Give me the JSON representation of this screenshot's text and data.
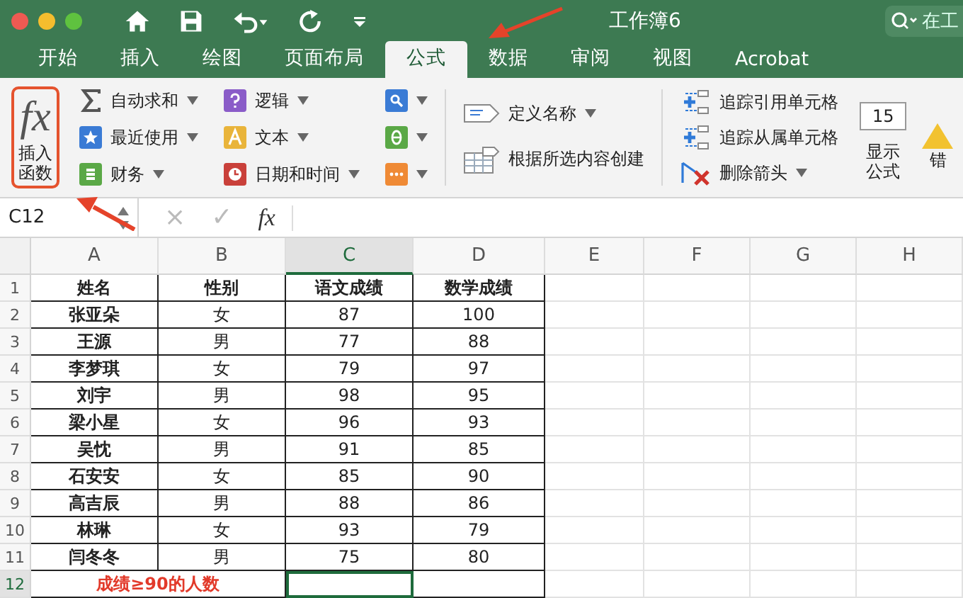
{
  "window": {
    "title": "工作簿6",
    "search": {
      "placeholder": "在工"
    }
  },
  "tabs": [
    {
      "label": "开始",
      "selected": false
    },
    {
      "label": "插入",
      "selected": false
    },
    {
      "label": "绘图",
      "selected": false
    },
    {
      "label": "页面布局",
      "selected": false
    },
    {
      "label": "公式",
      "selected": true
    },
    {
      "label": "数据",
      "selected": false
    },
    {
      "label": "审阅",
      "selected": false
    },
    {
      "label": "视图",
      "selected": false
    },
    {
      "label": "Acrobat",
      "selected": false
    }
  ],
  "ribbon": {
    "insert_function": {
      "symbol": "fx",
      "label": "插入函数",
      "highlighted": true
    },
    "library": [
      {
        "label": "自动求和",
        "kind": "sigma",
        "color": "#555555"
      },
      {
        "label": "最近使用",
        "kind": "star",
        "color": "#3a7bd5"
      },
      {
        "label": "财务",
        "kind": "stack",
        "color": "#5aa846"
      },
      {
        "label": "逻辑",
        "kind": "question",
        "color": "#8a5cc8"
      },
      {
        "label": "文本",
        "kind": "letter",
        "color": "#e9b43a"
      },
      {
        "label": "日期和时间",
        "kind": "clock",
        "color": "#c9403a"
      },
      {
        "kind": "lookup",
        "color": "#3a7bd5"
      },
      {
        "kind": "theta",
        "color": "#5aa846"
      },
      {
        "kind": "more",
        "color": "#ef8a35"
      }
    ],
    "names": [
      {
        "label": "定义名称",
        "dropdown": true
      },
      {
        "label": "根据所选内容创建",
        "dropdown": false
      }
    ],
    "auditing": [
      {
        "label": "追踪引用单元格",
        "dropdown": false
      },
      {
        "label": "追踪从属单元格",
        "dropdown": false
      },
      {
        "label": "删除箭头",
        "dropdown": true
      }
    ],
    "show_formulas": {
      "badge": "15",
      "label": "显示公式"
    },
    "error_check": {
      "label": "错"
    }
  },
  "formula_bar": {
    "name_box": "C12",
    "cancel": "×",
    "enter": "✓",
    "fx": "fx"
  },
  "columns": [
    {
      "label": "A",
      "selected": false
    },
    {
      "label": "B",
      "selected": false
    },
    {
      "label": "C",
      "selected": true
    },
    {
      "label": "D",
      "selected": false
    },
    {
      "label": "E",
      "selected": false
    },
    {
      "label": "F",
      "selected": false
    },
    {
      "label": "G",
      "selected": false
    },
    {
      "label": "H",
      "selected": false
    }
  ],
  "rows": [
    {
      "num": "1",
      "kind": "header",
      "selected": false,
      "cells": [
        "姓名",
        "性别",
        "语文成绩",
        "数学成绩"
      ]
    },
    {
      "num": "2",
      "kind": "data",
      "selected": false,
      "cells": [
        "张亚朵",
        "女",
        "87",
        "100"
      ]
    },
    {
      "num": "3",
      "kind": "data",
      "selected": false,
      "cells": [
        "王源",
        "男",
        "77",
        "88"
      ]
    },
    {
      "num": "4",
      "kind": "data",
      "selected": false,
      "cells": [
        "李梦琪",
        "女",
        "79",
        "97"
      ]
    },
    {
      "num": "5",
      "kind": "data",
      "selected": false,
      "cells": [
        "刘宇",
        "男",
        "98",
        "95"
      ]
    },
    {
      "num": "6",
      "kind": "data",
      "selected": false,
      "cells": [
        "梁小星",
        "女",
        "96",
        "93"
      ]
    },
    {
      "num": "7",
      "kind": "data",
      "selected": false,
      "cells": [
        "吴忱",
        "男",
        "91",
        "85"
      ]
    },
    {
      "num": "8",
      "kind": "data",
      "selected": false,
      "cells": [
        "石安安",
        "女",
        "85",
        "90"
      ]
    },
    {
      "num": "9",
      "kind": "data",
      "selected": false,
      "cells": [
        "高吉辰",
        "男",
        "88",
        "86"
      ]
    },
    {
      "num": "10",
      "kind": "data",
      "selected": false,
      "cells": [
        "林琳",
        "女",
        "93",
        "79"
      ]
    },
    {
      "num": "11",
      "kind": "data",
      "selected": false,
      "cells": [
        "闫冬冬",
        "男",
        "75",
        "80"
      ]
    },
    {
      "num": "12",
      "kind": "summary",
      "selected": true,
      "cells": [
        "成绩≥90的人数"
      ]
    }
  ]
}
